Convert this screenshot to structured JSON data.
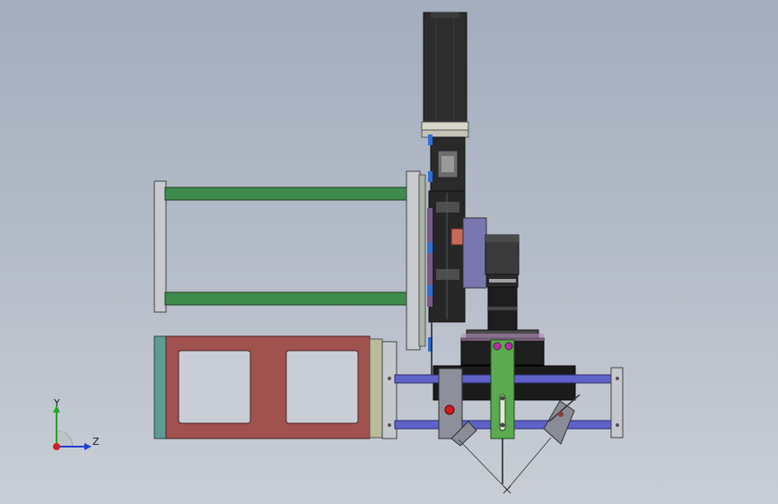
{
  "viewport": {
    "background_top": "#a3adbd",
    "background_bottom": "#c9ced6"
  },
  "triad": {
    "y_label": "Y",
    "z_label": "Z",
    "y_color": "#1fa61f",
    "z_color": "#1f3fd1",
    "x_color": "#d11f1f"
  },
  "colors": {
    "rail_green": "#3e8a4a",
    "frame_red": "#a0524f",
    "rod_blue": "#5f62c9",
    "bracket_green": "#5caa4f",
    "motor_dark": "#2f2f2f",
    "plate_grey": "#c5c8cc",
    "plate_teal": "#5e9b94",
    "block_salmon": "#c86a5a",
    "clip_blue": "#2b6fd8"
  }
}
